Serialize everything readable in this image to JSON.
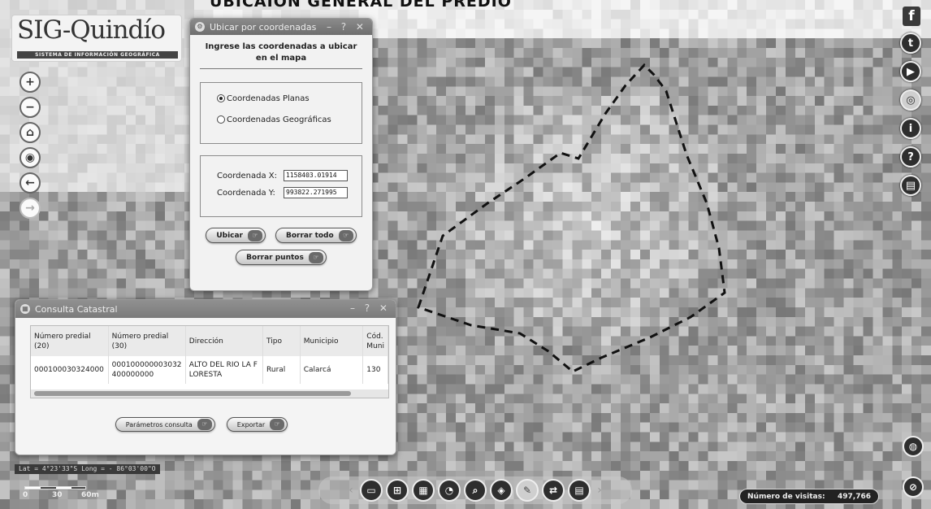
{
  "page_heading": "UBICAIÓN GENERAL DEL PREDIO",
  "logo": {
    "title": "SIG-Quindío",
    "subtitle": "SISTEMA DE INFORMACIÓN GEOGRÁFICA"
  },
  "left_tools": [
    {
      "name": "zoom-in",
      "glyph": "+"
    },
    {
      "name": "zoom-out",
      "glyph": "−"
    },
    {
      "name": "home",
      "glyph": "⌂"
    },
    {
      "name": "locate",
      "glyph": "◉"
    },
    {
      "name": "back",
      "glyph": "←"
    },
    {
      "name": "forward",
      "glyph": "→"
    }
  ],
  "right_tools": [
    {
      "name": "facebook",
      "glyph": "f"
    },
    {
      "name": "twitter",
      "glyph": "t"
    },
    {
      "name": "youtube",
      "glyph": "▶"
    },
    {
      "name": "web",
      "glyph": "◎"
    },
    {
      "name": "info",
      "glyph": "i"
    },
    {
      "name": "help",
      "glyph": "?"
    },
    {
      "name": "document",
      "glyph": "▤"
    }
  ],
  "coord_dialog": {
    "title": "Ubicar por coordenadas",
    "controls": "– ? ✕",
    "heading": "Ingrese las coordenadas a ubicar en el mapa",
    "radio_planas": "Coordenadas Planas",
    "radio_geograficas": "Coordenadas Geográficas",
    "selected": "planas",
    "label_x": "Coordenada X:",
    "label_y": "Coordenada Y:",
    "value_x": "1158403.01914",
    "value_y": "993822.271995",
    "btn_ubicar": "Ubicar",
    "btn_borrar_todo": "Borrar todo",
    "btn_borrar_puntos": "Borrar puntos"
  },
  "cadastral_dialog": {
    "title": "Consulta Catastral",
    "controls": "– ? ✕",
    "columns": [
      "Número predial (20)",
      "Número predial (30)",
      "Dirección",
      "Tipo",
      "Municipio",
      "Cód. Muni"
    ],
    "rows": [
      [
        "000100030324000",
        "000100000003032400000000",
        "ALTO DEL RIO LA FLORESTA",
        "Rural",
        "Calarcá",
        "130"
      ]
    ],
    "btn_parametros": "Parámetros consulta",
    "btn_exportar": "Exportar"
  },
  "status": {
    "latlong": "Lat = 4°23'33\"S Long = - 86°03'00\"O",
    "scale_labels": [
      "0",
      "30",
      "60m"
    ]
  },
  "bottom_toolbar": [
    {
      "name": "layers",
      "glyph": "▭"
    },
    {
      "name": "add-layer",
      "glyph": "⊞"
    },
    {
      "name": "print",
      "glyph": "▦"
    },
    {
      "name": "measure",
      "glyph": "◔"
    },
    {
      "name": "search",
      "glyph": "⌕"
    },
    {
      "name": "identify",
      "glyph": "◈"
    },
    {
      "name": "draw",
      "glyph": "✎"
    },
    {
      "name": "swipe",
      "glyph": "⇄"
    },
    {
      "name": "table",
      "glyph": "▤"
    }
  ],
  "visits": {
    "label": "Número de visitas:",
    "value": "497,766"
  },
  "corner_buttons": [
    {
      "name": "globe",
      "glyph": "◍"
    },
    {
      "name": "visibility",
      "glyph": "⊘"
    }
  ]
}
